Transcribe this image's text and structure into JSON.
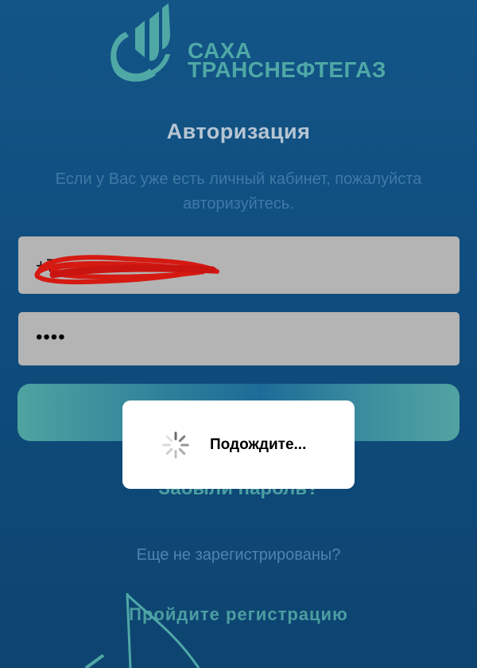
{
  "brand": {
    "line1": "САХА",
    "line2": "ТРАНСНЕФТЕГАЗ",
    "color": "#4fa8a6"
  },
  "auth": {
    "title": "Авторизация",
    "subtitle": "Если у Вас уже есть личный кабинет, пожалуйста авторизуйтесь.",
    "phone_value": "+7",
    "password_value": "••••"
  },
  "links": {
    "forgot": "Забыли пароль?",
    "not_registered": "Еще не зарегистрированы?",
    "register": "Пройдите регистрацию"
  },
  "loading": {
    "text": "Подождите..."
  },
  "colors": {
    "accent": "#4fa8a6",
    "background": "#135587"
  }
}
